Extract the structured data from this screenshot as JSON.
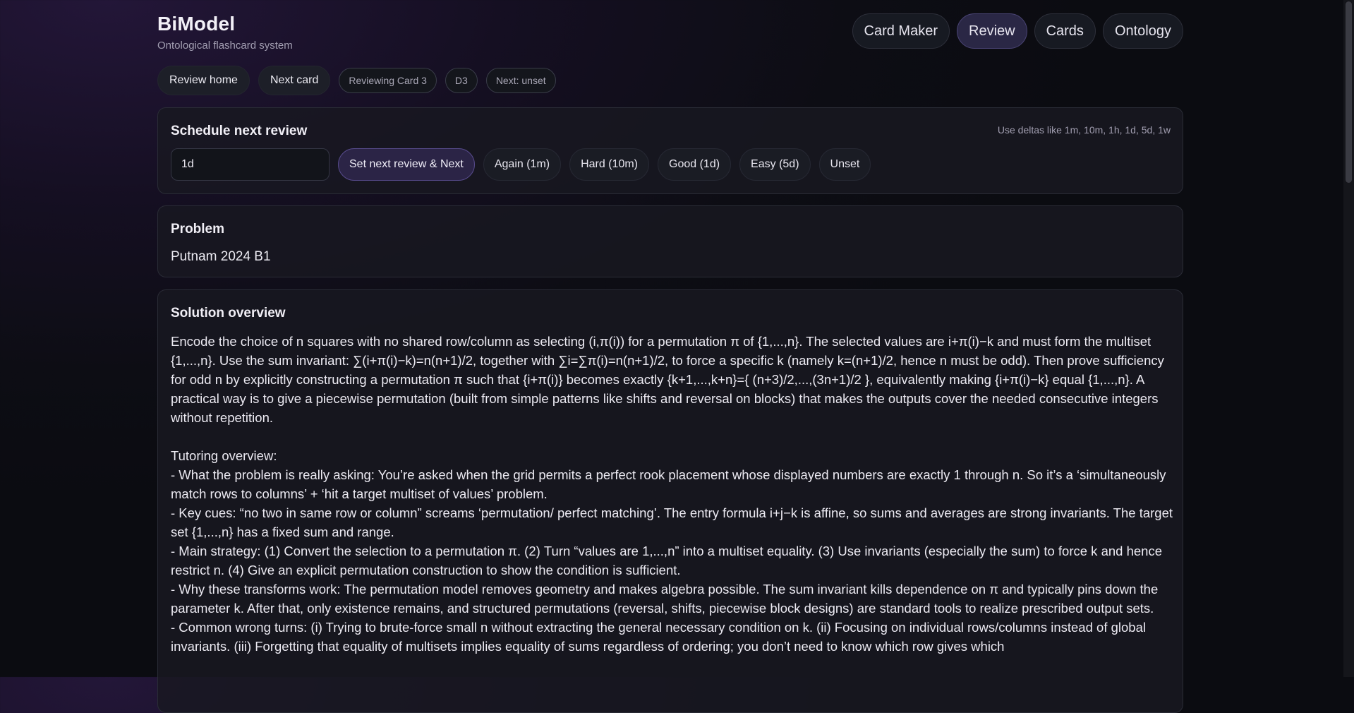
{
  "brand": {
    "title": "BiModel",
    "subtitle": "Ontological flashcard system"
  },
  "nav": [
    {
      "label": "Card Maker",
      "active": false
    },
    {
      "label": "Review",
      "active": true
    },
    {
      "label": "Cards",
      "active": false
    },
    {
      "label": "Ontology",
      "active": false
    }
  ],
  "toolbar": {
    "review_home": "Review home",
    "next_card": "Next card",
    "badges": [
      "Reviewing Card 3",
      "D3",
      "Next: unset"
    ]
  },
  "schedule": {
    "title": "Schedule next review",
    "hint": "Use deltas like 1m, 10m, 1h, 1d, 5d, 1w",
    "input_value": "1d",
    "primary": "Set next review & Next",
    "buttons": [
      "Again (1m)",
      "Hard (10m)",
      "Good (1d)",
      "Easy (5d)",
      "Unset"
    ]
  },
  "problem": {
    "title": "Problem",
    "text": "Putnam 2024 B1"
  },
  "solution": {
    "title": "Solution overview",
    "body": "Encode the choice of n squares with no shared row/column as selecting (i,π(i)) for a permutation π of {1,...,n}. The selected values are i+π(i)−k and must form the multiset {1,...,n}. Use the sum invariant: ∑(i+π(i)−k)=n(n+1)/2, together with ∑i=∑π(i)=n(n+1)/2, to force a specific k (namely k=(n+1)/2, hence n must be odd). Then prove sufficiency for odd n by explicitly constructing a permutation π such that {i+π(i)} becomes exactly {k+1,...,k+n}={ (n+3)/2,...,(3n+1)/2 }, equivalently making {i+π(i)−k} equal {1,...,n}. A practical way is to give a piecewise permutation (built from simple patterns like shifts and reversal on blocks) that makes the outputs cover the needed consecutive integers without repetition.\n\nTutoring overview:\n- What the problem is really asking: You’re asked when the grid permits a perfect rook placement whose displayed numbers are exactly 1 through n. So it’s a ‘simultaneously match rows to columns’ + ‘hit a target multiset of values’ problem.\n- Key cues: “no two in same row or column” screams ‘permutation/ perfect matching’. The entry formula i+j−k is affine, so sums and averages are strong invariants. The target set {1,...,n} has a fixed sum and range.\n- Main strategy: (1) Convert the selection to a permutation π. (2) Turn “values are 1,...,n” into a multiset equality. (3) Use invariants (especially the sum) to force k and hence restrict n. (4) Give an explicit permutation construction to show the condition is sufficient.\n- Why these transforms work: The permutation model removes geometry and makes algebra possible. The sum invariant kills dependence on π and typically pins down the parameter k. After that, only existence remains, and structured permutations (reversal, shifts, piecewise block designs) are standard tools to realize prescribed output sets.\n- Common wrong turns: (i) Trying to brute-force small n without extracting the general necessary condition on k. (ii) Focusing on individual rows/columns instead of global invariants. (iii) Forgetting that equality of multisets implies equality of sums regardless of ordering; you don’t need to know which row gives which"
  }
}
